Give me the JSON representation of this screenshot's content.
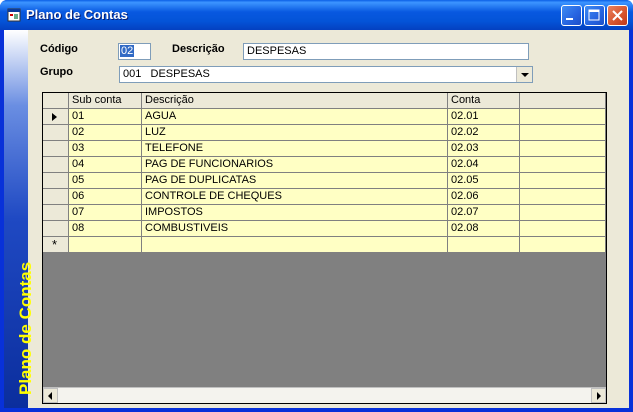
{
  "window": {
    "title": "Plano de Contas"
  },
  "sidebar": {
    "caption": "Plano de Contas"
  },
  "form": {
    "codigo_label": "Código",
    "codigo_value": "02",
    "descricao_label": "Descrição",
    "descricao_value": "DESPESAS",
    "grupo_label": "Grupo",
    "grupo_value": "001   DESPESAS"
  },
  "grid": {
    "columns": [
      "Sub conta",
      "Descrição",
      "Conta",
      ""
    ],
    "rows": [
      [
        "01",
        "AGUA",
        "02.01"
      ],
      [
        "02",
        "LUZ",
        "02.02"
      ],
      [
        "03",
        "TELEFONE",
        "02.03"
      ],
      [
        "04",
        "PAG DE FUNCIONARIOS",
        "02.04"
      ],
      [
        "05",
        "PAG DE DUPLICATAS",
        "02.05"
      ],
      [
        "06",
        "CONTROLE DE CHEQUES",
        "02.06"
      ],
      [
        "07",
        "IMPOSTOS",
        "02.07"
      ],
      [
        "08",
        "COMBUSTIVEIS",
        "02.08"
      ]
    ],
    "new_row_marker": "*"
  }
}
